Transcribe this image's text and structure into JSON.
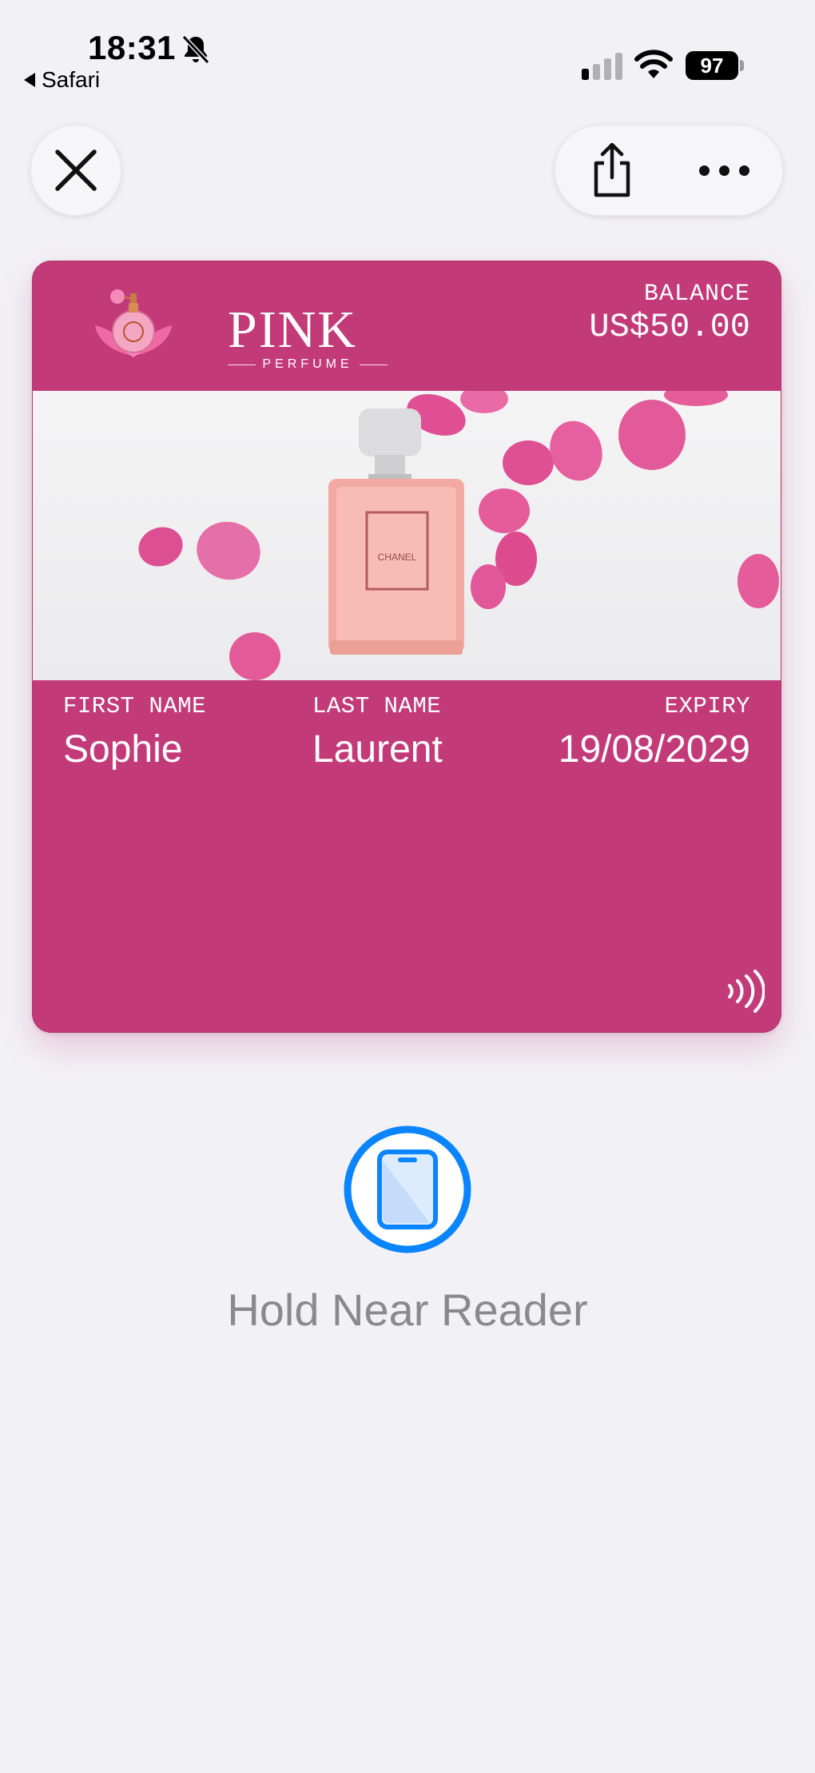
{
  "status_bar": {
    "time": "18:31",
    "back_app": "Safari",
    "battery": "97",
    "icons": [
      "bell-slash-icon",
      "cellular-signal-icon",
      "wifi-icon",
      "battery-icon"
    ]
  },
  "controls": {
    "close_icon": "close-icon",
    "share_icon": "share-icon",
    "more_icon": "more-icon"
  },
  "card": {
    "brand": "PINK",
    "brand_sub": "PERFUME",
    "balance_label": "BALANCE",
    "balance_value": "US$50.00",
    "fields": {
      "first_name_label": "FIRST NAME",
      "first_name_value": "Sophie",
      "last_name_label": "LAST NAME",
      "last_name_value": "Laurent",
      "expiry_label": "EXPIRY",
      "expiry_value": "19/08/2029"
    },
    "strip_bottle_label": "CHANEL",
    "colors": {
      "card_background": "#c23a78",
      "petal": "#e0508f",
      "bottle": "#f1a9a4"
    }
  },
  "reader": {
    "icon": "iphone-reader-icon",
    "text": "Hold Near Reader",
    "accent": "#0a84ff"
  }
}
